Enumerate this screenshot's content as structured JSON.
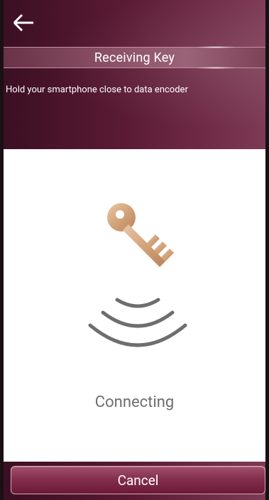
{
  "header": {
    "title": "Receiving Key",
    "subtitle": "Hold your smartphone close to data encoder"
  },
  "main": {
    "status": "Connecting"
  },
  "footer": {
    "cancel_label": "Cancel"
  },
  "colors": {
    "header_bg": "#5a1a34",
    "key_gold": "#d4a57a",
    "wave_gray": "#6e6e6e"
  },
  "icons": {
    "back": "arrow-left-icon",
    "key": "key-icon",
    "wave": "wireless-signal-icon"
  }
}
